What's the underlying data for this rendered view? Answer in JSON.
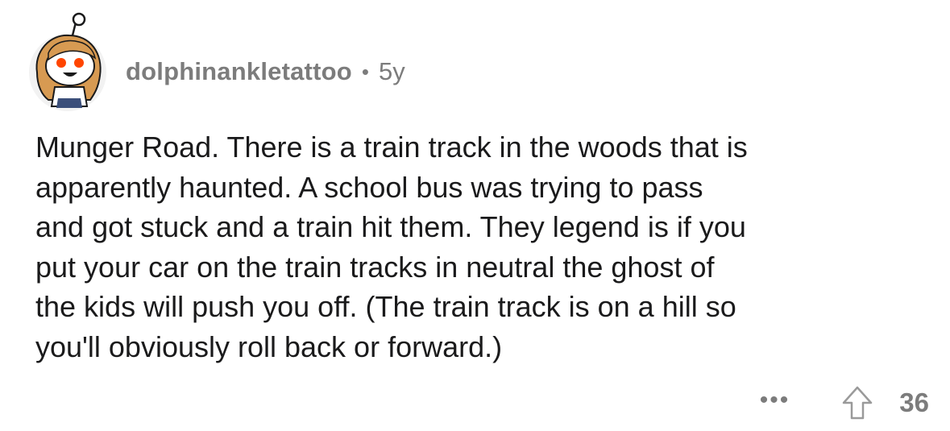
{
  "comment": {
    "author": "dolphinankletattoo",
    "separator": "•",
    "age": "5y",
    "body_lines": [
      "Munger Road. There is a train track in the woods that is",
      "apparently haunted. A school bus was trying to pass",
      "and got stuck and a train hit them. They legend is if you",
      "put your car on the train tracks in neutral the ghost of",
      "the kids will push you off. (The train track is on a hill so",
      "you'll obviously roll back or forward.)"
    ],
    "more_label": "•••",
    "upvote_icon": "upvote-arrow-icon",
    "score": "36"
  },
  "colors": {
    "meta_text": "#7c7c7c",
    "body_text": "#1a1a1b",
    "background": "#ffffff"
  }
}
